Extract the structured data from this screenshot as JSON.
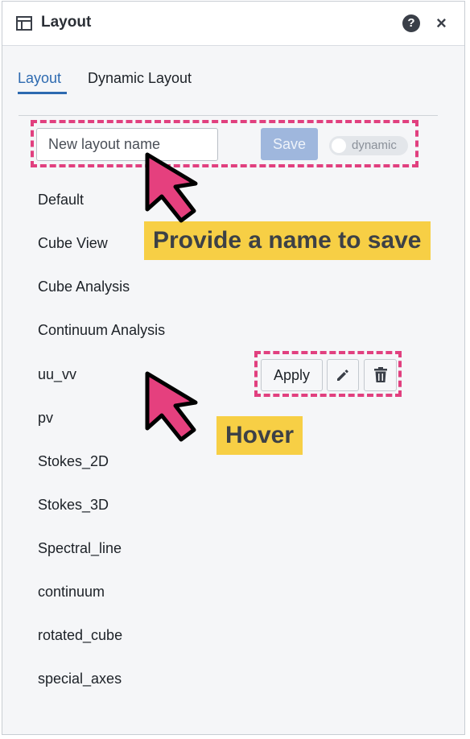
{
  "window": {
    "title": "Layout",
    "title_icon": "layout-panel-icon",
    "help_icon": "question-circle-icon",
    "help_glyph": "?",
    "close_icon": "close-icon",
    "close_glyph": "×"
  },
  "tabs": [
    {
      "label": "Layout",
      "active": true
    },
    {
      "label": "Dynamic Layout",
      "active": false
    }
  ],
  "save_form": {
    "input_value": "New layout name",
    "save_label": "Save",
    "toggle_label": "dynamic",
    "toggle_on": false
  },
  "layouts": [
    "Default",
    "Cube View",
    "Cube Analysis",
    "Continuum Analysis",
    "uu_vv",
    "pv",
    "Stokes_2D",
    "Stokes_3D",
    "Spectral_line",
    "continuum",
    "rotated_cube",
    "special_axes"
  ],
  "hover_actions": {
    "apply_label": "Apply",
    "edit_icon": "pencil-icon",
    "delete_icon": "trash-icon"
  },
  "annotations": {
    "save_callout": "Provide a name to save",
    "hover_callout": "Hover",
    "highlight_color": "#e1407f",
    "callout_color": "#f7cf45",
    "arrow_color": "#e5407e"
  },
  "colors": {
    "accent": "#2d6ab0",
    "save_disabled": "#9fb7dd"
  }
}
